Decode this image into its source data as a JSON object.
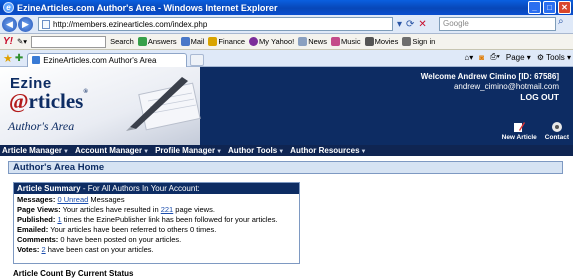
{
  "window": {
    "title": "EzineArticles.com Author's Area - Windows Internet Explorer",
    "url": "http://members.ezinearticles.com/index.php",
    "search_placeholder": "Google"
  },
  "yahoo_toolbar": {
    "search_label": "Search",
    "items": [
      "Answers",
      "Mail",
      "Finance",
      "My Yahoo!",
      "News",
      "Music",
      "Movies",
      "Sign in"
    ]
  },
  "tabs": {
    "active_label": "EzineArticles.com Author's Area",
    "page_label": "Page",
    "tools_label": "Tools"
  },
  "header": {
    "logo_ezine": "Ezine",
    "logo_articles_at": "@",
    "logo_articles_rest": "rticles",
    "logo_reg": "®",
    "logo_authors": "Author's Area",
    "welcome": "Welcome Andrew Cimino [ID: 67586]",
    "email": "andrew_cimino@hotmail.com",
    "logout": "LOG OUT",
    "new_article": "New Article",
    "contact": "Contact"
  },
  "menu": [
    {
      "label": "Article Manager"
    },
    {
      "label": "Account Manager"
    },
    {
      "label": "Profile Manager"
    },
    {
      "label": "Author Tools"
    },
    {
      "label": "Author Resources"
    }
  ],
  "main": {
    "title": "Author's Area Home",
    "summary_title_bold": "Article Summary",
    "summary_title_rest": " - For All Authors In Your Account:",
    "rows": {
      "messages_label": "Messages:",
      "messages_link": "0 Unread",
      "messages_rest": " Messages",
      "pageviews_label": "Page Views:",
      "pageviews_pre": " Your articles have resulted in ",
      "pageviews_link": "221",
      "pageviews_post": " page views.",
      "published_label": "Published:",
      "published_link": "1",
      "published_rest": " times the EzinePublisher link has been followed for your articles.",
      "emailed_label": "Emailed:",
      "emailed_rest": " Your articles have been referred to others 0 times.",
      "comments_label": "Comments:",
      "comments_rest": " 0 have been posted on your articles.",
      "votes_label": "Votes:",
      "votes_link": "2",
      "votes_rest": " have been cast on your articles."
    },
    "count_label": "Article Count By Current Status"
  }
}
